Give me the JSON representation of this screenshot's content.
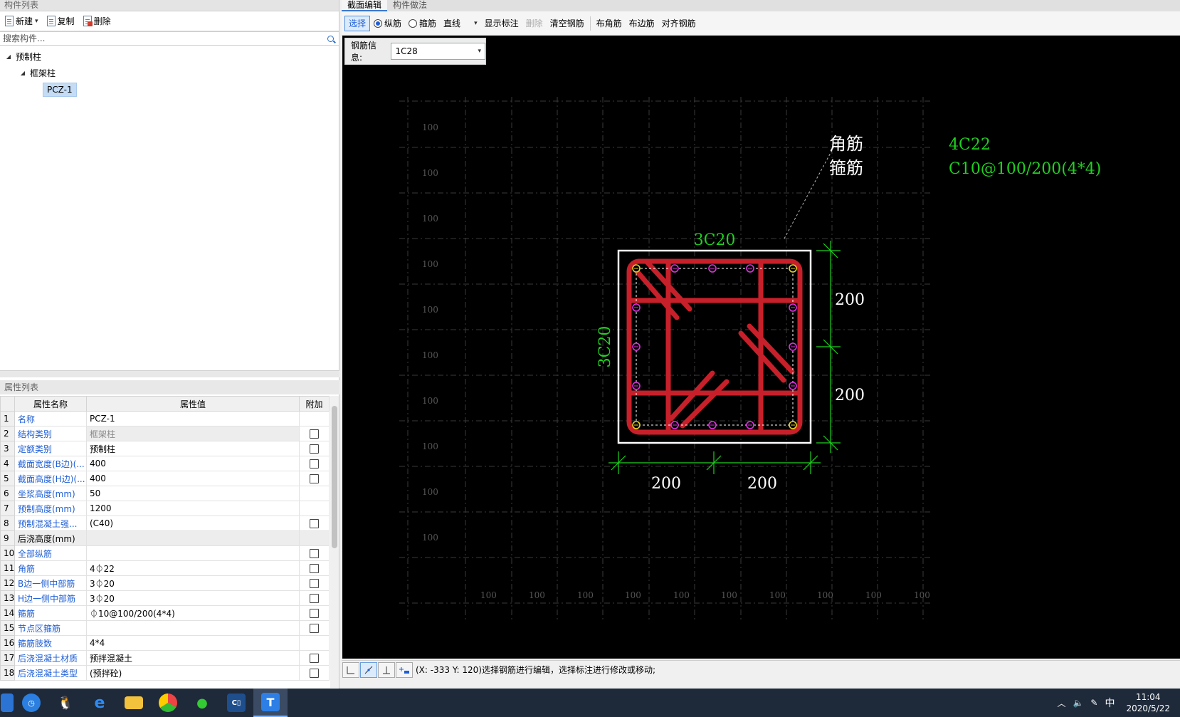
{
  "left": {
    "component_list_title": "构件列表",
    "toolbar": {
      "new_label": "新建",
      "copy_label": "复制",
      "delete_label": "删除"
    },
    "search": {
      "placeholder": "搜索构件..."
    },
    "tree": {
      "root": "预制柱",
      "child": "框架柱",
      "leaf": "PCZ-1"
    },
    "props_title": "属性列表",
    "props_headers": {
      "name": "属性名称",
      "value": "属性值",
      "extra": "附加"
    },
    "props": [
      {
        "n": "1",
        "name": "名称",
        "value": "PCZ-1",
        "check": false
      },
      {
        "n": "2",
        "name": "结构类别",
        "value": "框架柱",
        "check": true
      },
      {
        "n": "3",
        "name": "定额类别",
        "value": "预制柱",
        "check": true
      },
      {
        "n": "4",
        "name": "截面宽度(B边)(...",
        "value": "400",
        "check": true
      },
      {
        "n": "5",
        "name": "截面高度(H边)(...",
        "value": "400",
        "check": true
      },
      {
        "n": "6",
        "name": "坐浆高度(mm)",
        "value": "50",
        "check": false
      },
      {
        "n": "7",
        "name": "预制高度(mm)",
        "value": "1200",
        "check": false
      },
      {
        "n": "8",
        "name": "预制混凝土强...",
        "value": "(C40)",
        "check": true
      },
      {
        "n": "9",
        "name": "后浇高度(mm)",
        "value": "",
        "check": false
      },
      {
        "n": "10",
        "name": "全部纵筋",
        "value": "",
        "check": true
      },
      {
        "n": "11",
        "name": "角筋",
        "value": "4⏀22",
        "check": true
      },
      {
        "n": "12",
        "name": "B边一侧中部筋",
        "value": "3⏀20",
        "check": true
      },
      {
        "n": "13",
        "name": "H边一侧中部筋",
        "value": "3⏀20",
        "check": true
      },
      {
        "n": "14",
        "name": "箍筋",
        "value": "⏀10@100/200(4*4)",
        "check": true
      },
      {
        "n": "15",
        "name": "节点区箍筋",
        "value": "",
        "check": true
      },
      {
        "n": "16",
        "name": "箍筋肢数",
        "value": "4*4",
        "check": false
      },
      {
        "n": "17",
        "name": "后浇混凝土材质",
        "value": "预拌混凝土",
        "check": true
      },
      {
        "n": "18",
        "name": "后浇混凝土类型",
        "value": "(预拌砼)",
        "check": true
      }
    ]
  },
  "right": {
    "tabs": [
      "截面编辑",
      "构件做法"
    ],
    "toolbar": {
      "select": "选择",
      "longitudinal": "纵筋",
      "stirrup": "箍筋",
      "line_mode": "直线",
      "show_dims": "显示标注",
      "delete": "删除",
      "clear": "清空钢筋",
      "corner": "布角筋",
      "edge": "布边筋",
      "align": "对齐钢筋"
    },
    "rebar_info_label": "钢筋信息:",
    "rebar_info_value": "1C28",
    "drawing": {
      "grid_label": "100",
      "corner_label": "角筋",
      "corner_value": "4C22",
      "stirrup_label": "箍筋",
      "stirrup_value": "C10@100/200(4*4)",
      "top_label": "3C20",
      "left_label": "3C20",
      "dim_200": "200"
    },
    "status_text": "(X: -333 Y: 120)选择钢筋进行编辑，选择标注进行修改或移动;"
  },
  "taskbar": {
    "time": "11:04",
    "date": "2020/5/22",
    "ime": "中"
  },
  "colors": {
    "rebar_red": "#c8202a",
    "dim_green": "#1fd11f",
    "corner_yellow": "#e5d21a",
    "mid_magenta": "#e030e0"
  }
}
